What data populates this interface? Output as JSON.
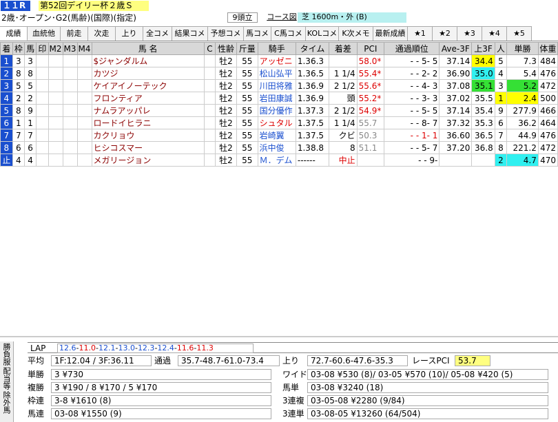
{
  "header": {
    "race_no": "１１R",
    "race_name": "第52回デイリー杯２歳Ｓ",
    "conditions": "2歳･オープン･G2(馬齢)(国際)(指定)",
    "heads": "9頭立",
    "course_label": "コース図",
    "course": "芝 1600m・外 (B)"
  },
  "tabs": [
    "成績",
    "血統他",
    "前走",
    "次走",
    "上り",
    "全コメ",
    "結果コメ",
    "予想コメ",
    "馬コメ",
    "C馬コメ",
    "KOLコメ",
    "K次メモ",
    "最新成績",
    "★1",
    "★2",
    "★3",
    "★4",
    "★5"
  ],
  "columns": [
    "着",
    "枠",
    "馬",
    "印",
    "M2",
    "M3",
    "M4",
    "馬 名",
    "C",
    "性齢",
    "斤量",
    "騎手",
    "タイム",
    "着差",
    "PCI",
    "通過順位",
    "Ave-3F",
    "上3F",
    "人",
    "単勝",
    "体重"
  ],
  "rows": [
    {
      "order": "1",
      "waku": "3",
      "uma": "3",
      "name": "$ジャンダルム",
      "sexage": "牡2",
      "kin": "55",
      "jockey": "アッゼニ",
      "jc": "red",
      "time": "1.36.3",
      "diff": "",
      "pci": "58.0*",
      "pc": "red",
      "pass": "-   -   5-  5",
      "ave": "37.14",
      "up": "34.4",
      "uc": "yel",
      "pop": "5",
      "pc2": "",
      "odds": "7.3",
      "oc": "",
      "weight": "484"
    },
    {
      "order": "2",
      "waku": "8",
      "uma": "8",
      "name": "カツジ",
      "sexage": "牡2",
      "kin": "55",
      "jockey": "松山弘平",
      "jc": "blue",
      "time": "1.36.5",
      "diff": "1 1/4",
      "pci": "55.4*",
      "pc": "red",
      "pass": "-   -   2-  2",
      "ave": "36.90",
      "up": "35.0",
      "uc": "cyan",
      "pop": "4",
      "pc2": "",
      "odds": "5.4",
      "oc": "",
      "weight": "476"
    },
    {
      "order": "3",
      "waku": "5",
      "uma": "5",
      "name": "ケイアイノーテック",
      "sexage": "牡2",
      "kin": "55",
      "jockey": "川田将雅",
      "jc": "blue",
      "time": "1.36.9",
      "diff": "2 1/2",
      "pci": "55.6*",
      "pc": "red",
      "pass": "-   -   4-  3",
      "ave": "37.08",
      "up": "35.1",
      "uc": "grn",
      "pop": "3",
      "pc2": "",
      "odds": "5.2",
      "oc": "grn",
      "weight": "472"
    },
    {
      "order": "4",
      "waku": "2",
      "uma": "2",
      "name": "フロンティア",
      "sexage": "牡2",
      "kin": "55",
      "jockey": "岩田康誠",
      "jc": "blue",
      "time": "1.36.9",
      "diff": "頭",
      "pci": "55.2*",
      "pc": "red",
      "pass": "-   -   3-  3",
      "ave": "37.02",
      "up": "35.5",
      "uc": "",
      "pop": "1",
      "pc2": "yel",
      "odds": "2.4",
      "oc": "yel",
      "weight": "500"
    },
    {
      "order": "5",
      "waku": "8",
      "uma": "9",
      "name": "ナムラアッパレ",
      "sexage": "牡2",
      "kin": "55",
      "jockey": "国分優作",
      "jc": "blue",
      "time": "1.37.3",
      "diff": "2 1/2",
      "pci": "54.9*",
      "pc": "red",
      "pass": "-   -   5-  5",
      "ave": "37.14",
      "up": "35.4",
      "uc": "",
      "pop": "9",
      "pc2": "",
      "odds": "277.9",
      "oc": "",
      "weight": "466"
    },
    {
      "order": "6",
      "waku": "1",
      "uma": "1",
      "name": "ロードイヒラニ",
      "sexage": "牡2",
      "kin": "55",
      "jockey": "シュタル",
      "jc": "red",
      "time": "1.37.5",
      "diff": "1 1/4",
      "pci": "55.7",
      "pc": "gray",
      "pass": "-   -   8-  7",
      "ave": "37.32",
      "up": "35.3",
      "uc": "",
      "pop": "6",
      "pc2": "",
      "odds": "36.2",
      "oc": "",
      "weight": "464"
    },
    {
      "order": "7",
      "waku": "7",
      "uma": "7",
      "name": "カクリョウ",
      "sexage": "牡2",
      "kin": "55",
      "jockey": "岩崎翼",
      "jc": "blue",
      "time": "1.37.5",
      "diff": "クビ",
      "pci": "50.3",
      "pc": "gray",
      "pass": "-   -   1-  1",
      "ave": "36.60",
      "up": "36.5",
      "uc": "",
      "pop": "7",
      "pc2": "",
      "odds": "44.9",
      "oc": "",
      "weight": "476"
    },
    {
      "order": "8",
      "waku": "6",
      "uma": "6",
      "name": "ヒシコスマー",
      "sexage": "牡2",
      "kin": "55",
      "jockey": "浜中俊",
      "jc": "blue",
      "time": "1.38.8",
      "diff": "8",
      "pci": "51.1",
      "pc": "gray",
      "pass": "-   -   5-  7",
      "ave": "37.20",
      "up": "36.8",
      "uc": "",
      "pop": "8",
      "pc2": "",
      "odds": "221.2",
      "oc": "",
      "weight": "472"
    },
    {
      "order": "止",
      "waku": "4",
      "uma": "4",
      "name": "メガリージョン",
      "sexage": "牡2",
      "kin": "55",
      "jockey": "Ｍ．デム",
      "jc": "blue",
      "time": "------",
      "diff": "中止",
      "pci": "",
      "pc": "",
      "pass": "-   -   9-",
      "ave": "",
      "up": "",
      "uc": "",
      "pop": "2",
      "pc2": "cyan",
      "odds": "4.7",
      "oc": "cyan",
      "weight": "470"
    }
  ],
  "side_tabs": [
    "勝負服",
    "配当等",
    "除外馬"
  ],
  "bottom": {
    "lap_label": "LAP",
    "lap_value": "12.6-11.0-12.1-13.0-12.3-12.4-11.6-11.3",
    "avg_label": "平均",
    "avg_value": "1F:12.04 / 3F:36.11",
    "pass_label": "通過",
    "pass_value": "35.7-48.7-61.0-73.4",
    "up_label": "上り",
    "up_value": "72.7-60.6-47.6-35.3",
    "pci_label": "レースPCI",
    "pci_value": "53.7",
    "tansho_label": "単勝",
    "tansho": "3 ¥730",
    "fukusho_label": "複勝",
    "fukusho": "3 ¥190 / 8 ¥170 / 5 ¥170",
    "wakuren_label": "枠連",
    "wakuren": "3-8 ¥1610 (8)",
    "umaren_label": "馬連",
    "umaren": "03-08 ¥1550 (9)",
    "wide_label": "ワイド",
    "wide": "03-08 ¥530 (8)/ 03-05 ¥570 (10)/ 05-08 ¥420 (5)",
    "umatan_label": "馬単",
    "umatan": "03-08 ¥3240 (18)",
    "sanrenpuku_label": "3連複",
    "sanrenpuku": "03-05-08 ¥2280 (9/84)",
    "sanrentan_label": "3連単",
    "sanrentan": "03-08-05 ¥13260 (64/504)"
  }
}
